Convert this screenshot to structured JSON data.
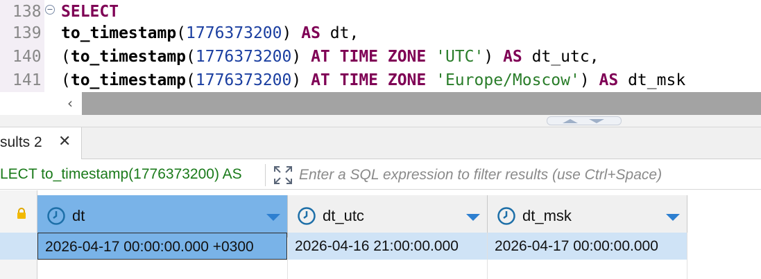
{
  "editor": {
    "lines": [
      {
        "number": "138",
        "fold": "−",
        "tokens": [
          {
            "t": "SELECT",
            "c": "kw"
          }
        ]
      },
      {
        "number": "139",
        "tokens": [
          {
            "t": "to_timestamp",
            "c": "fn"
          },
          {
            "t": "(",
            "c": ""
          },
          {
            "t": "1776373200",
            "c": "num"
          },
          {
            "t": ") ",
            "c": ""
          },
          {
            "t": "AS",
            "c": "kw"
          },
          {
            "t": " dt,",
            "c": ""
          }
        ]
      },
      {
        "number": "140",
        "tokens": [
          {
            "t": "(",
            "c": ""
          },
          {
            "t": "to_timestamp",
            "c": "fn"
          },
          {
            "t": "(",
            "c": ""
          },
          {
            "t": "1776373200",
            "c": "num"
          },
          {
            "t": ") ",
            "c": ""
          },
          {
            "t": "AT TIME ZONE",
            "c": "kw"
          },
          {
            "t": " ",
            "c": ""
          },
          {
            "t": "'UTC'",
            "c": "str"
          },
          {
            "t": ") ",
            "c": ""
          },
          {
            "t": "AS",
            "c": "kw"
          },
          {
            "t": " dt_utc,",
            "c": ""
          }
        ]
      },
      {
        "number": "141",
        "tokens": [
          {
            "t": "(",
            "c": ""
          },
          {
            "t": "to_timestamp",
            "c": "fn"
          },
          {
            "t": "(",
            "c": ""
          },
          {
            "t": "1776373200",
            "c": "num"
          },
          {
            "t": ") ",
            "c": ""
          },
          {
            "t": "AT TIME ZONE",
            "c": "kw"
          },
          {
            "t": " ",
            "c": ""
          },
          {
            "t": "'Europe/Moscow'",
            "c": "str"
          },
          {
            "t": ") ",
            "c": ""
          },
          {
            "t": "AS",
            "c": "kw"
          },
          {
            "t": " dt_msk",
            "c": ""
          }
        ]
      }
    ],
    "scroll_left_icon": "chevron-left-icon"
  },
  "results_tab": {
    "label": "sults 2",
    "close_icon": "close-icon",
    "close_glyph": "✕"
  },
  "filter": {
    "query_text": "LECT to_timestamp(1776373200) AS",
    "placeholder": "Enter a SQL expression to filter results (use Ctrl+Space)",
    "expand_icon": "expand-icon"
  },
  "grid": {
    "columns": [
      {
        "name": "dt",
        "icon": "clock-icon"
      },
      {
        "name": "dt_utc",
        "icon": "clock-icon"
      },
      {
        "name": "dt_msk",
        "icon": "clock-icon"
      }
    ],
    "rows": [
      [
        "2026-04-17 00:00:00.000 +0300",
        "2026-04-16 21:00:00.000",
        "2026-04-17 00:00:00.000"
      ]
    ]
  },
  "colors": {
    "keyword": "#7f0055",
    "number": "#1a3ea0",
    "string": "#2a7d2a",
    "selected_header": "#79b3e8",
    "selected_row": "#cfe3f6"
  }
}
